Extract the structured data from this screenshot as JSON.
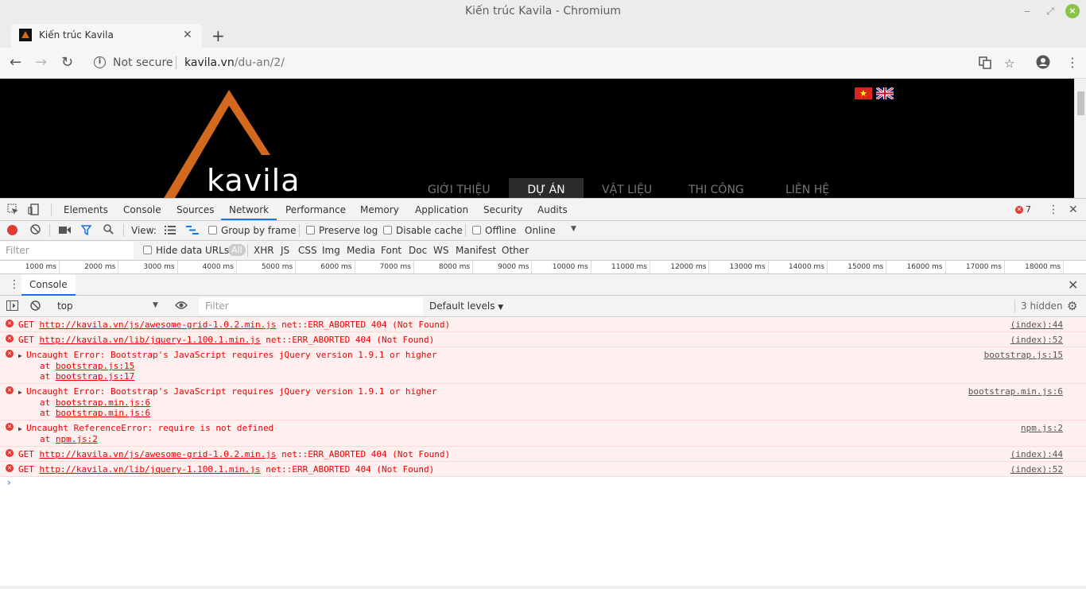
{
  "window": {
    "title": "Kiến trúc Kavila - Chromium"
  },
  "tab": {
    "label": "Kiến trúc Kavila"
  },
  "omnibox": {
    "security_text": "Not secure",
    "url_host": "kavila.vn",
    "url_path": "/du-an/2/"
  },
  "site": {
    "logo_text": "kavila",
    "brand_color": "#d2691e",
    "menu": [
      "GIỚI THIỆU",
      "DỰ ÁN",
      "VẬT LIỆU",
      "THI CÔNG",
      "LIÊN HỆ"
    ],
    "active_menu": "DỰ ÁN"
  },
  "devtools": {
    "tabs": [
      "Elements",
      "Console",
      "Sources",
      "Network",
      "Performance",
      "Memory",
      "Application",
      "Security",
      "Audits"
    ],
    "active_tab": "Network",
    "error_count": "7",
    "network": {
      "view_label": "View:",
      "group_by_frame": "Group by frame",
      "preserve_log": "Preserve log",
      "disable_cache": "Disable cache",
      "offline": "Offline",
      "throttle": "Online",
      "filter_placeholder": "Filter",
      "hide_data_urls": "Hide data URLs",
      "types": [
        "All",
        "XHR",
        "JS",
        "CSS",
        "Img",
        "Media",
        "Font",
        "Doc",
        "WS",
        "Manifest",
        "Other"
      ],
      "ticks": [
        "1000 ms",
        "2000 ms",
        "3000 ms",
        "4000 ms",
        "5000 ms",
        "6000 ms",
        "7000 ms",
        "8000 ms",
        "9000 ms",
        "10000 ms",
        "11000 ms",
        "12000 ms",
        "13000 ms",
        "14000 ms",
        "15000 ms",
        "16000 ms",
        "17000 ms",
        "18000 ms"
      ]
    },
    "console": {
      "drawer_tab": "Console",
      "context": "top",
      "filter_placeholder": "Filter",
      "levels": "Default levels",
      "hidden": "3 hidden",
      "messages": [
        {
          "prefix": "GET ",
          "link": "http://kavila.vn/js/awesome-grid-1.0.2.min.js",
          "suffix": " net::ERR_ABORTED 404 (Not Found)",
          "source": "(index):44"
        },
        {
          "prefix": "GET ",
          "link": "http://kavila.vn/lib/jquery-1.100.1.min.js",
          "suffix": " net::ERR_ABORTED 404 (Not Found)",
          "source": "(index):52"
        },
        {
          "text": "Uncaught Error: Bootstrap's JavaScript requires jQuery version 1.9.1 or higher",
          "stack": [
            "bootstrap.js:15",
            "bootstrap.js:17"
          ],
          "source": "bootstrap.js:15"
        },
        {
          "text": "Uncaught Error: Bootstrap's JavaScript requires jQuery version 1.9.1 or higher",
          "stack": [
            "bootstrap.min.js:6",
            "bootstrap.min.js:6"
          ],
          "source": "bootstrap.min.js:6"
        },
        {
          "text": "Uncaught ReferenceError: require is not defined",
          "stack": [
            "npm.js:2"
          ],
          "source": "npm.js:2"
        },
        {
          "prefix": "GET ",
          "link": "http://kavila.vn/js/awesome-grid-1.0.2.min.js",
          "suffix": " net::ERR_ABORTED 404 (Not Found)",
          "source": "(index):44"
        },
        {
          "prefix": "GET ",
          "link": "http://kavila.vn/lib/jquery-1.100.1.min.js",
          "suffix": " net::ERR_ABORTED 404 (Not Found)",
          "source": "(index):52"
        }
      ],
      "stack_prefix": "at "
    }
  },
  "icons": {
    "minimize": "minimize-icon",
    "maximize": "maximize-icon",
    "close": "close-icon",
    "back": "back-arrow-icon",
    "forward": "forward-arrow-icon",
    "reload": "reload-icon",
    "translate": "translate-icon",
    "star": "star-icon",
    "account": "account-icon",
    "menu": "kebab-menu-icon"
  }
}
